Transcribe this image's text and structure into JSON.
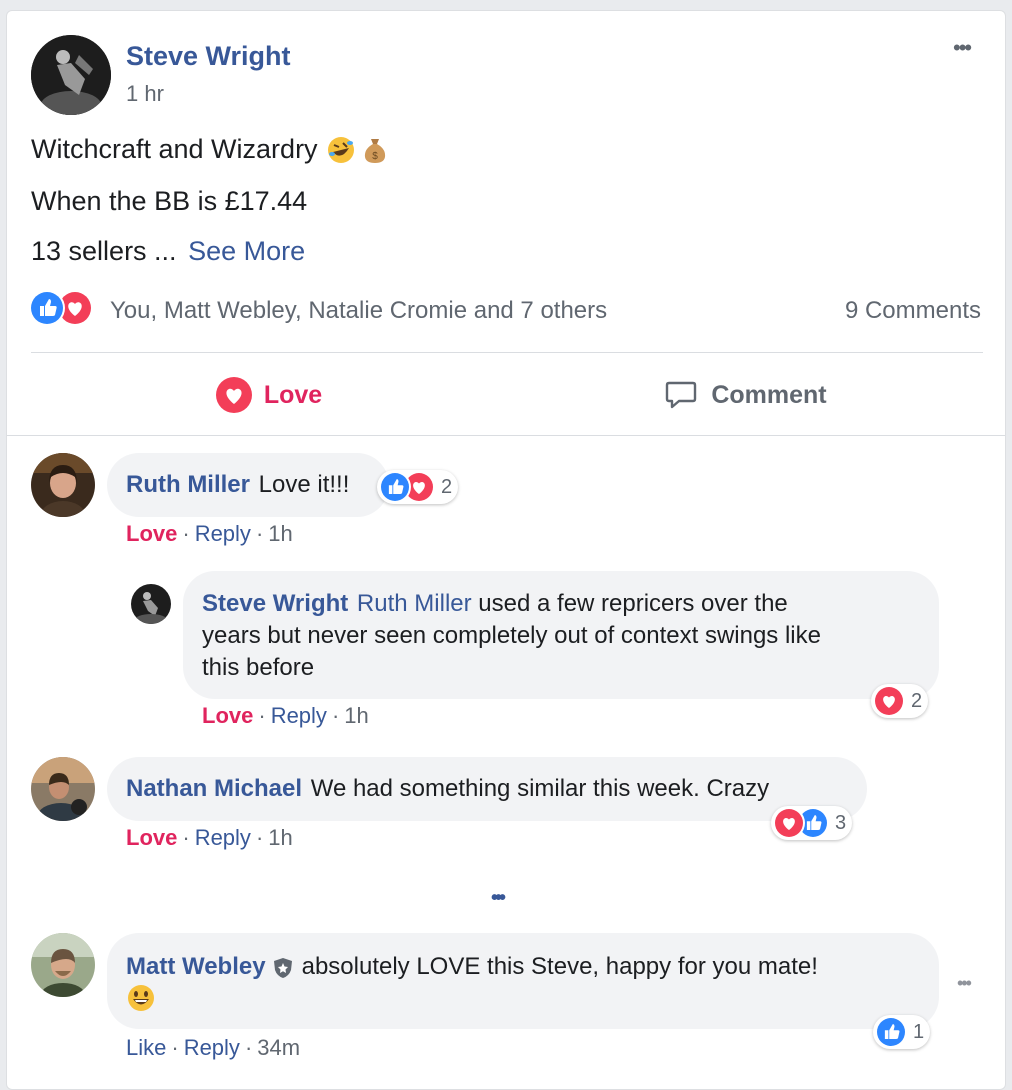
{
  "post": {
    "author": "Steve Wright",
    "time": "1 hr",
    "more_label": "•••",
    "line1": "Witchcraft and Wizardry",
    "line2": "When the BB is £17.44",
    "line3": "13 sellers ...",
    "see_more": "See More",
    "reactions_text": "You, Matt Webley, Natalie Cromie and 7 others",
    "comments_count": "9 Comments",
    "action_love": "Love",
    "action_comment": "Comment",
    "icons": [
      "like-icon",
      "heart-icon",
      "rofl-emoji-icon",
      "money-bag-emoji-icon",
      "comment-icon"
    ]
  },
  "comments": [
    {
      "author": "Ruth Miller",
      "text": "Love it!!!",
      "reaction_count": "2",
      "action_reaction": "Love",
      "action_reply": "Reply",
      "time": "1h",
      "reactions": [
        "like",
        "heart"
      ]
    },
    {
      "author": "Steve Wright",
      "mention": "Ruth Miller",
      "text_line1": "used a few repricers over the",
      "text_line2": "years but never seen completely out of context swings like",
      "text_line3": "this before",
      "reaction_count": "2",
      "action_reaction": "Love",
      "action_reply": "Reply",
      "time": "1h",
      "reactions": [
        "heart"
      ]
    },
    {
      "author": "Nathan Michael",
      "text": "We had something similar this week. Crazy",
      "reaction_count": "3",
      "action_reaction": "Love",
      "action_reply": "Reply",
      "time": "1h",
      "reactions": [
        "heart",
        "like"
      ]
    },
    {
      "author": "Matt Webley",
      "text_line1": "absolutely LOVE this Steve, happy for you mate!",
      "reaction_count": "1",
      "action_reaction": "Like",
      "action_reply": "Reply",
      "time": "34m",
      "reactions": [
        "like"
      ]
    }
  ],
  "more_replies_label": "•••",
  "comment_more_label": "•••",
  "separator": "·",
  "colors": {
    "link": "#385898",
    "love": "#e0245e",
    "like_blue": "#2d86ff",
    "heart_red": "#f33e58",
    "bubble": "#f2f3f5"
  }
}
